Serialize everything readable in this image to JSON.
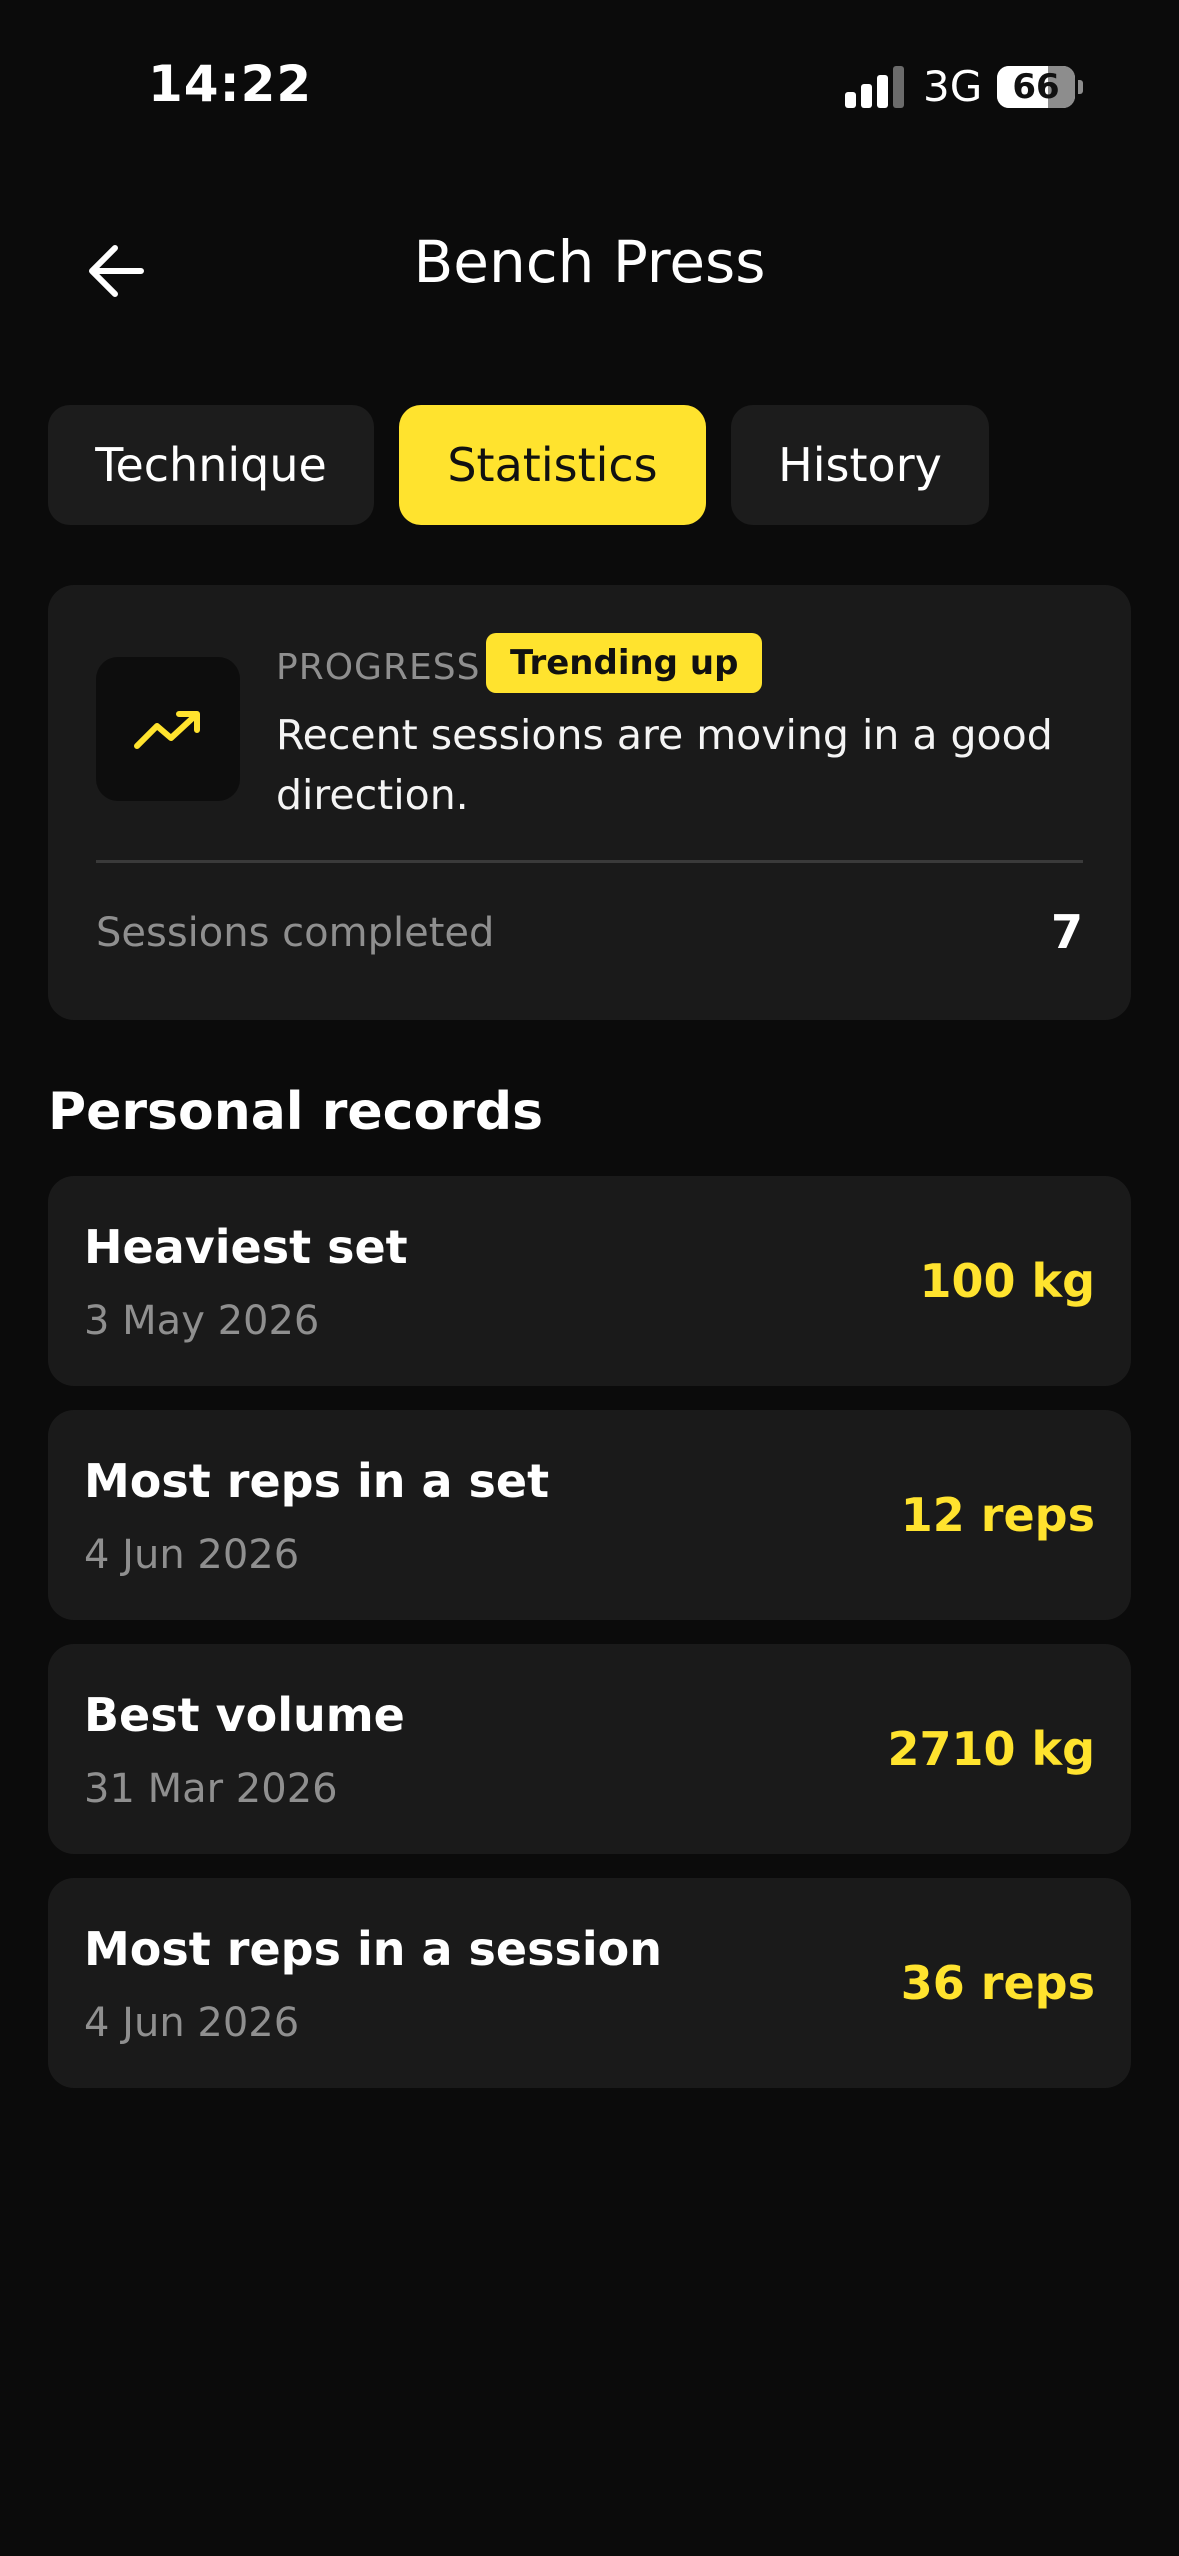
{
  "status_bar": {
    "time": "14:22",
    "network": "3G",
    "battery": "66",
    "battery_level": 0.66
  },
  "header": {
    "title": "Bench Press",
    "back_icon": "arrow-left-icon"
  },
  "tabs": [
    {
      "label": "Technique",
      "active": false
    },
    {
      "label": "Statistics",
      "active": true
    },
    {
      "label": "History",
      "active": false
    }
  ],
  "progress": {
    "label": "PROGRESS",
    "badge": "Trending up",
    "icon": "trending-up-icon",
    "message": "Recent sessions are moving in a good direction.",
    "sessions_label": "Sessions completed",
    "sessions_value": "7"
  },
  "records": {
    "title": "Personal records",
    "items": [
      {
        "title": "Heaviest set",
        "date": "3 May 2026",
        "value": "100 kg"
      },
      {
        "title": "Most reps in a set",
        "date": "4 Jun 2026",
        "value": "12 reps"
      },
      {
        "title": "Best volume",
        "date": "31 Mar 2026",
        "value": "2710 kg"
      },
      {
        "title": "Most reps in a session",
        "date": "4 Jun 2026",
        "value": "36 reps"
      }
    ]
  },
  "colors": {
    "accent": "#ffe32e",
    "background": "#0b0b0b",
    "card": "#1a1a1a"
  }
}
